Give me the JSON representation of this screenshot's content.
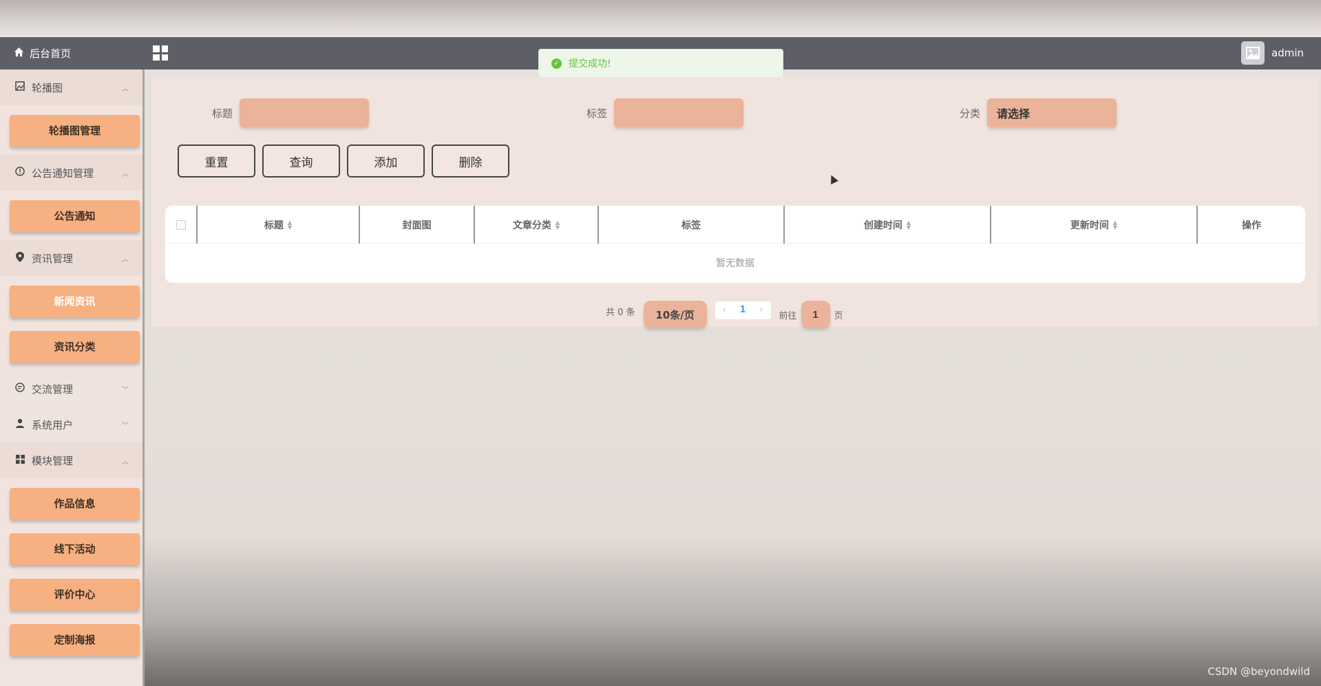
{
  "header": {
    "home_label": "后台首页",
    "title": "",
    "username": "admin"
  },
  "toast": {
    "message": "提交成功!"
  },
  "sidebar": {
    "groups": [
      {
        "label": "轮播图",
        "expanded": true,
        "items": [
          "轮播图管理"
        ]
      },
      {
        "label": "公告通知管理",
        "expanded": true,
        "items": [
          "公告通知"
        ]
      },
      {
        "label": "资讯管理",
        "expanded": true,
        "items": [
          "新闻资讯",
          "资讯分类"
        ]
      },
      {
        "label": "交流管理",
        "expanded": false,
        "items": []
      },
      {
        "label": "系统用户",
        "expanded": false,
        "items": []
      },
      {
        "label": "模块管理",
        "expanded": true,
        "items": [
          "作品信息",
          "线下活动",
          "评价中心",
          "定制海报"
        ]
      }
    ]
  },
  "filters": {
    "title_label": "标题",
    "title_value": "",
    "tag_label": "标签",
    "tag_value": "",
    "category_label": "分类",
    "category_placeholder": "请选择"
  },
  "buttons": {
    "reset": "重置",
    "query": "查询",
    "add": "添加",
    "delete": "删除"
  },
  "table": {
    "columns": [
      "标题",
      "封面图",
      "文章分类",
      "标签",
      "创建时间",
      "更新时间",
      "操作"
    ],
    "empty_text": "暂无数据"
  },
  "pagination": {
    "total_text": "共 0 条",
    "page_size": "10条/页",
    "current_page": "1",
    "goto_prefix": "前往",
    "goto_value": "1",
    "goto_suffix": "页"
  },
  "watermark": "CSDN @beyondwild"
}
